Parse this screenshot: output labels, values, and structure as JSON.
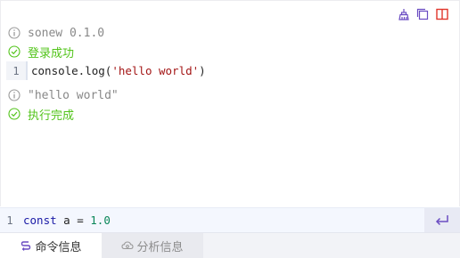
{
  "logs": [
    {
      "type": "info",
      "text": "sonew 0.1.0",
      "mono": true
    },
    {
      "type": "success",
      "text": "登录成功",
      "mono": false
    },
    {
      "type": "code",
      "line": "1",
      "code_prefix": "console.log(",
      "code_string": "'hello world'",
      "code_suffix": ")"
    },
    {
      "type": "info",
      "text": "\"hello world\"",
      "mono": true
    },
    {
      "type": "success",
      "text": "执行完成",
      "mono": false
    }
  ],
  "input": {
    "line": "1",
    "keyword": "const",
    "rest": " a = ",
    "number": "1.0"
  },
  "tabs": [
    {
      "label": "命令信息",
      "icon": "command-icon",
      "active": true
    },
    {
      "label": "分析信息",
      "icon": "cloud-analysis-icon",
      "active": false
    }
  ],
  "colors": {
    "success": "#52c41a",
    "info": "#888888",
    "accent": "#6a4cc2",
    "danger": "#e0352b"
  }
}
